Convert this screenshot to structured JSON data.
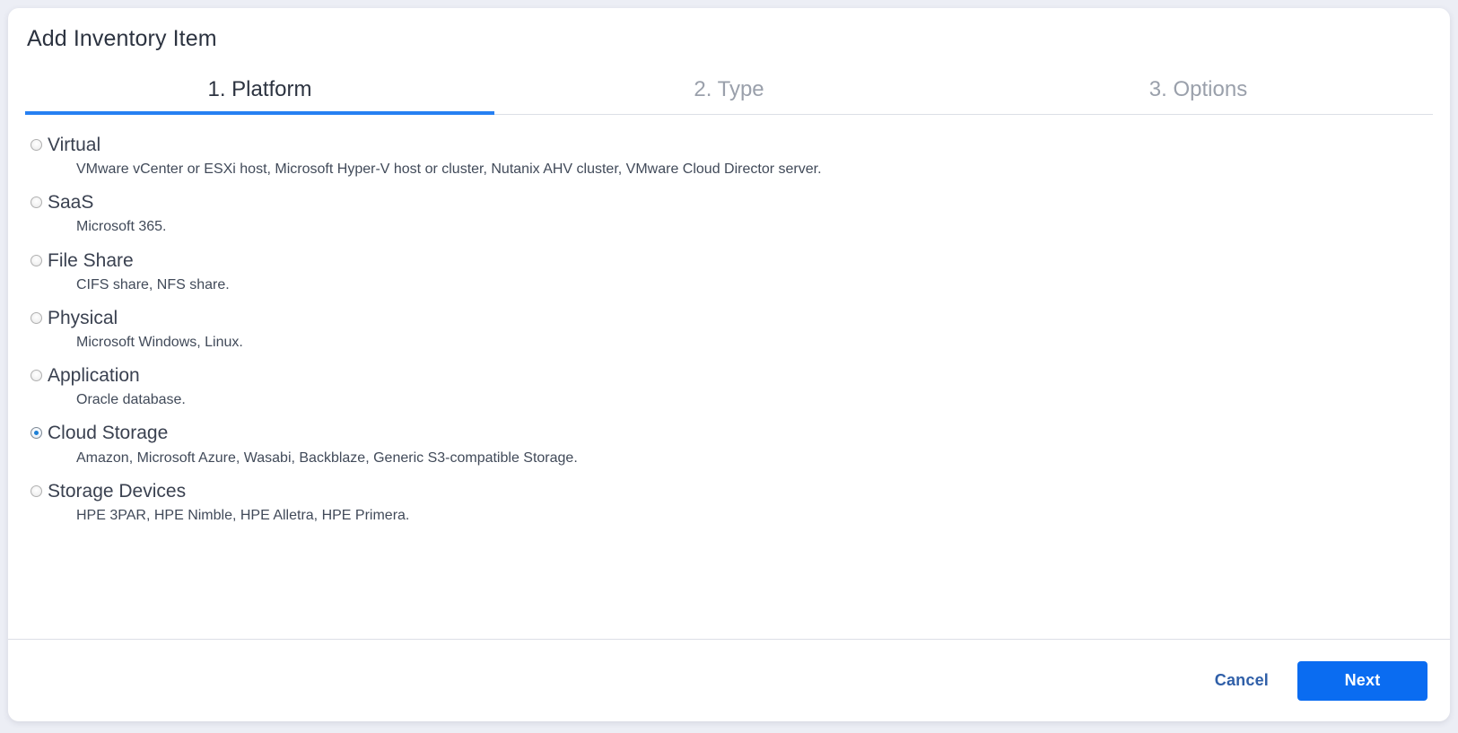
{
  "dialog": {
    "title": "Add Inventory Item"
  },
  "tabs": [
    {
      "label": "1. Platform",
      "active": true
    },
    {
      "label": "2. Type",
      "active": false
    },
    {
      "label": "3. Options",
      "active": false
    }
  ],
  "platform_options": [
    {
      "label": "Virtual",
      "description": "VMware vCenter or ESXi host, Microsoft Hyper-V host or cluster, Nutanix AHV cluster, VMware Cloud Director server.",
      "selected": false
    },
    {
      "label": "SaaS",
      "description": "Microsoft 365.",
      "selected": false
    },
    {
      "label": "File Share",
      "description": "CIFS share, NFS share.",
      "selected": false
    },
    {
      "label": "Physical",
      "description": "Microsoft Windows, Linux.",
      "selected": false
    },
    {
      "label": "Application",
      "description": "Oracle database.",
      "selected": false
    },
    {
      "label": "Cloud Storage",
      "description": "Amazon, Microsoft Azure, Wasabi, Backblaze, Generic S3-compatible Storage.",
      "selected": true
    },
    {
      "label": "Storage Devices",
      "description": "HPE 3PAR, HPE Nimble, HPE Alletra, HPE Primera.",
      "selected": false
    }
  ],
  "footer": {
    "cancel_label": "Cancel",
    "next_label": "Next"
  },
  "colors": {
    "accent": "#0a6cf1",
    "tab_underline": "#2680f2",
    "page_background": "#eceef5",
    "text_primary": "#2c3340",
    "text_muted": "#9aa0ab",
    "radio_selected_dot": "#1c7fd6"
  }
}
